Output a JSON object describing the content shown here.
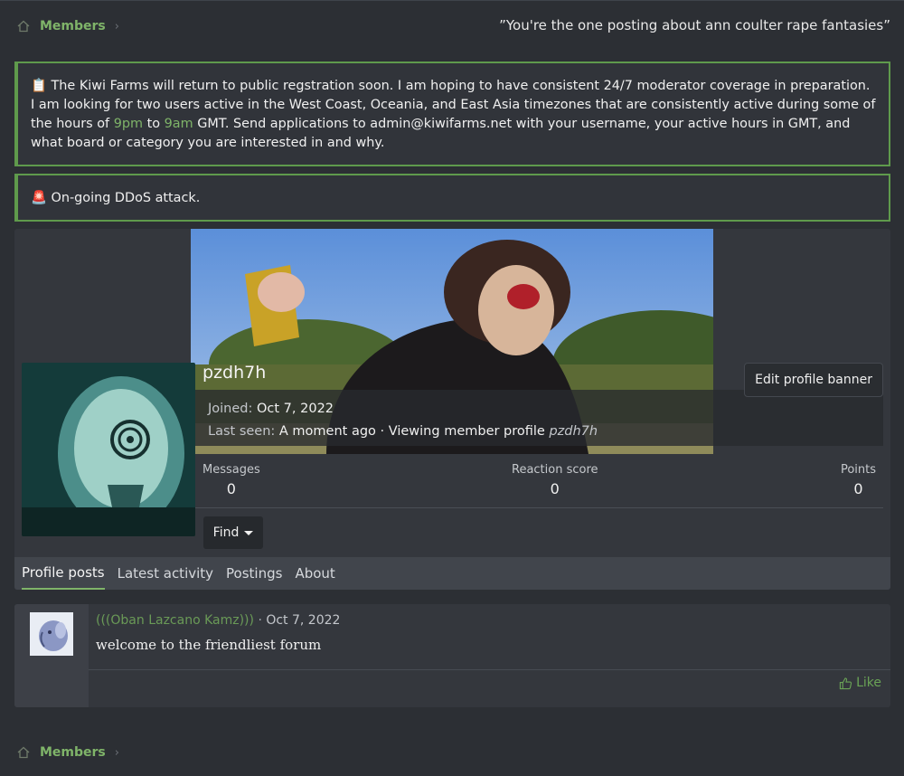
{
  "breadcrumb": {
    "label": "Members"
  },
  "header_quote": "”You're the one posting about ann coulter rape fantasies”",
  "notices": {
    "recruit": {
      "emoji": "📋",
      "text_a": "The Kiwi Farms will return to public regstration soon. I am hoping to have consistent 24/7 moderator coverage in preparation. I am looking for two users active in the West Coast, Oceania, and East Asia timezones that are consistently active during some of the hours of",
      "start_time": "9pm",
      "to": "to",
      "end_time": "9am",
      "text_b": "GMT. Send applications to admin@kiwifarms.net with your username, your active hours in GMT, and what board or category you are interested in and why."
    },
    "ddos": {
      "emoji": "🚨",
      "text": "On-going DDoS attack."
    }
  },
  "profile": {
    "username": "pzdh7h",
    "joined_label": "Joined:",
    "joined_value": "Oct 7, 2022",
    "last_seen_label": "Last seen:",
    "last_seen_value": "A moment ago · Viewing member profile",
    "last_seen_target": "pzdh7h",
    "edit_banner_label": "Edit profile banner",
    "stats": {
      "messages_label": "Messages",
      "messages_value": "0",
      "reaction_label": "Reaction score",
      "reaction_value": "0",
      "points_label": "Points",
      "points_value": "0"
    },
    "find_label": "Find",
    "tabs": [
      "Profile posts",
      "Latest activity",
      "Postings",
      "About"
    ]
  },
  "post": {
    "author": "(((Oban Lazcano Kamz)))",
    "separator": "·",
    "date": "Oct 7, 2022",
    "body": "welcome to the friendliest forum",
    "like_label": "Like"
  },
  "colors": {
    "accent": "#7fb469",
    "background": "#2c2f34",
    "card": "#34373d"
  },
  "icons": {
    "home": "home-icon",
    "chevron": "chevron-right-icon",
    "caret": "caret-down-icon",
    "like": "thumbs-up-icon"
  }
}
